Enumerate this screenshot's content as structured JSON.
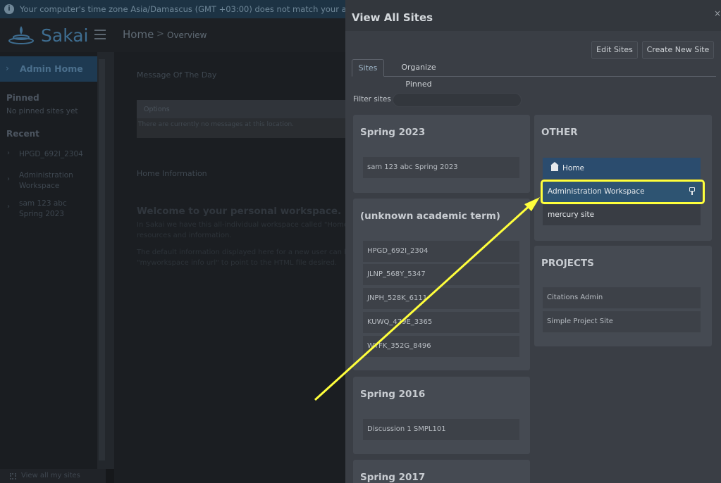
{
  "banner": {
    "text": "Your computer's time zone Asia/Damascus (GMT +03:00) does not match your account's time zone"
  },
  "header": {
    "logo_text": "Sakai",
    "breadcrumb_home": "Home",
    "breadcrumb_sep": ">",
    "breadcrumb_current": "Overview"
  },
  "leftnav": {
    "admin_home": "Admin Home",
    "pinned_heading": "Pinned",
    "pinned_empty": "No pinned sites yet",
    "recent_heading": "Recent",
    "recent_items": [
      {
        "label": "HPGD_692I_2304"
      },
      {
        "label": "Administration Workspace"
      },
      {
        "label": "sam 123 abc Spring 2023"
      }
    ],
    "view_all": "View all my sites"
  },
  "main": {
    "motd_title": "Message Of The Day",
    "options_label": "Options",
    "no_messages": "There are currently no messages at this location.",
    "home_info": "Home Information",
    "welcome_title": "Welcome to your personal workspace.",
    "welcome_line1": "In Sakai we have this all-individual workspace called \"Home\". It",
    "welcome_line2": "resources and information.",
    "welcome_line3": "The default information displayed here for a new user can be",
    "welcome_line4": "\"myworkspace info url\" to point to the HTML file desired."
  },
  "panel": {
    "title": "View All Sites",
    "close_label": "×",
    "edit_sites": "Edit Sites",
    "create_new_site": "Create New Site",
    "tabs": [
      {
        "label": "Sites",
        "active": true
      },
      {
        "label": "Organize Pinned",
        "active": false
      }
    ],
    "filter_label": "Filter sites",
    "filter_value": "",
    "terms": [
      {
        "title": "Spring 2023",
        "sites": [
          "sam 123 abc Spring 2023"
        ]
      },
      {
        "title": "(unknown academic term)",
        "sites": [
          "HPGD_692I_2304",
          "JLNP_568Y_5347",
          "JNPH_528K_6111",
          "KUWQ_479E_3365",
          "WYFK_352G_8496"
        ]
      },
      {
        "title": "Spring 2016",
        "sites": [
          "Discussion 1 SMPL101"
        ]
      },
      {
        "title": "Spring 2017",
        "sites": []
      }
    ],
    "other": {
      "title": "OTHER",
      "items": [
        "Home",
        "Administration Workspace",
        "mercury site"
      ]
    },
    "projects": {
      "title": "PROJECTS",
      "items": [
        "Citations Admin",
        "Simple Project Site"
      ]
    }
  },
  "colors": {
    "accent_blue": "#2e5472",
    "home_blue": "#2b4c6e",
    "highlight_yellow": "#ffff3c"
  }
}
